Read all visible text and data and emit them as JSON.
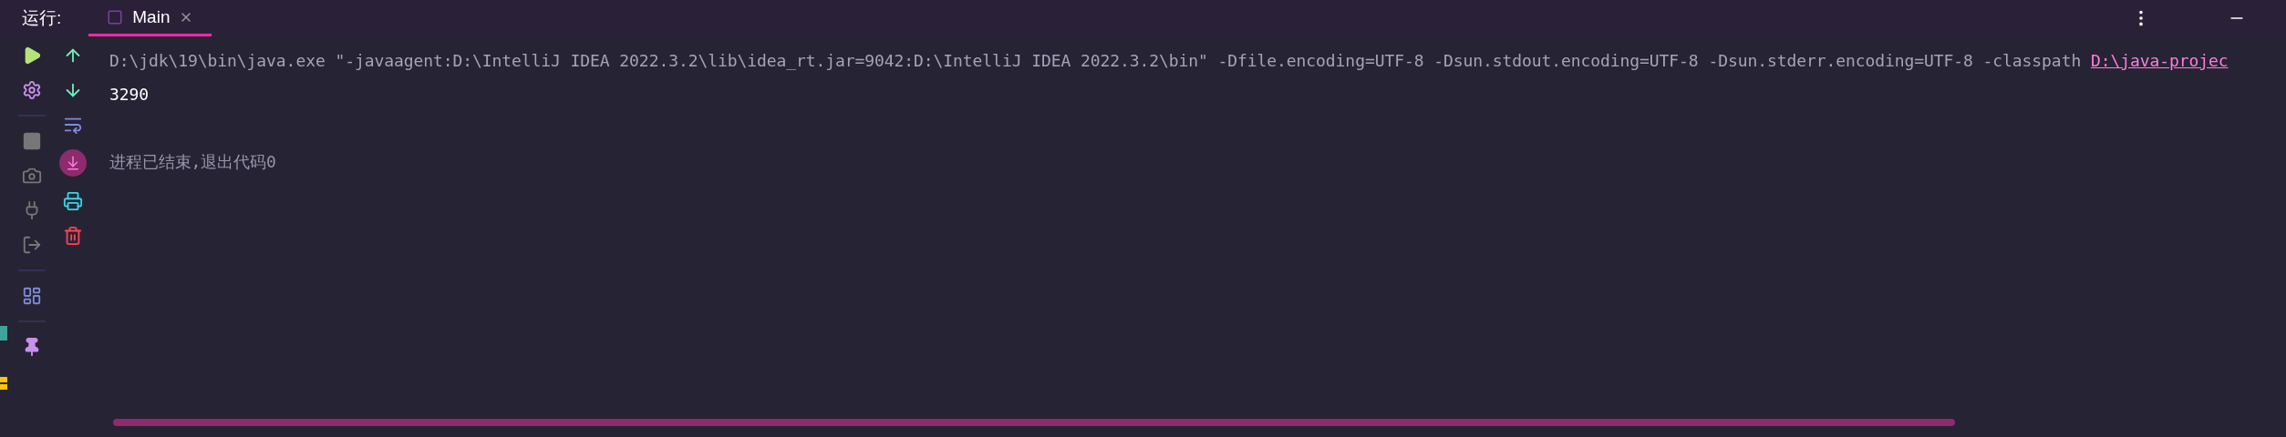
{
  "panel_title": "运行:",
  "tabs": [
    {
      "label": "Main",
      "selected": true
    }
  ],
  "console": [
    {
      "kind": "command",
      "text": "D:\\jdk\\19\\bin\\java.exe \"-javaagent:D:\\IntelliJ IDEA 2022.3.2\\lib\\idea_rt.jar=9042:D:\\IntelliJ IDEA 2022.3.2\\bin\" -Dfile.encoding=UTF-8 -Dsun.stdout.encoding=UTF-8 -Dsun.stderr.encoding=UTF-8 -classpath ",
      "link": "D:\\java-projec"
    },
    {
      "kind": "output",
      "text": "3290"
    },
    {
      "kind": "blank"
    },
    {
      "kind": "system",
      "text": "进程已结束,退出代码0"
    }
  ]
}
